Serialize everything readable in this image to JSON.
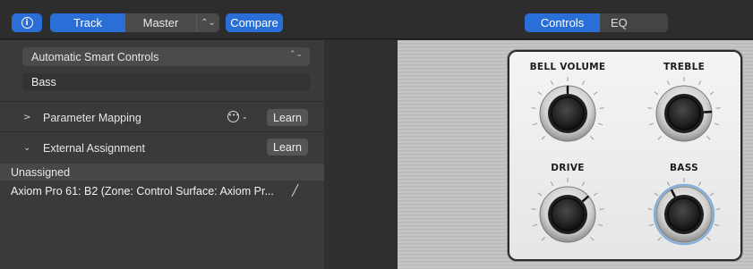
{
  "toolbar": {
    "info_icon": "i",
    "track_label": "Track",
    "master_label": "Master",
    "stepper_icon": "⌃⌄",
    "compare_label": "Compare"
  },
  "view_tabs": {
    "controls_label": "Controls",
    "eq_label": "EQ",
    "selected": "Controls"
  },
  "inspector": {
    "smart_controls_dropdown": "Automatic Smart Controls",
    "control_name": "Bass",
    "parameter_mapping": {
      "label": "Parameter Mapping",
      "learn_label": "Learn",
      "expanded": false
    },
    "external_assignment": {
      "label": "External Assignment",
      "learn_label": "Learn",
      "expanded": true
    },
    "assignment_list": {
      "header": "Unassigned",
      "rows": [
        "Axiom Pro 61: B2 (Zone: Control Surface: Axiom Pr..."
      ]
    }
  },
  "smart_controls": {
    "knobs": [
      {
        "label": "BELL VOLUME",
        "value": 0.5,
        "selected": false
      },
      {
        "label": "TREBLE",
        "value": 0.82,
        "selected": false
      },
      {
        "label": "DRIVE",
        "value": 0.68,
        "selected": false
      },
      {
        "label": "BASS",
        "value": 0.4,
        "selected": true
      }
    ],
    "selection_color": "#6a9fd8",
    "accent_color": "#2a6fd8"
  }
}
